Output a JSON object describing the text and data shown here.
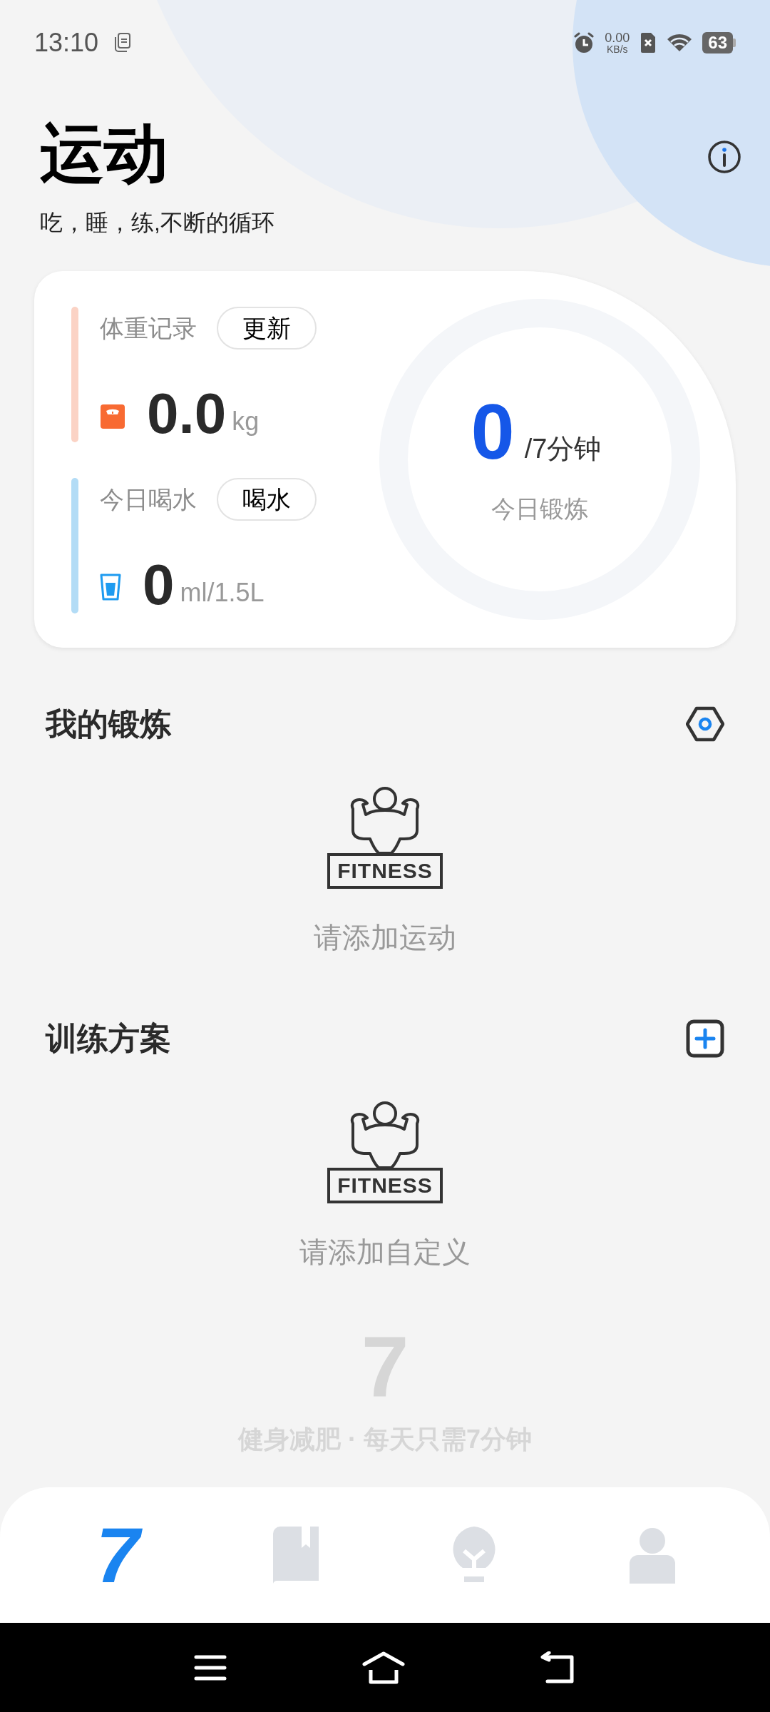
{
  "status_bar": {
    "time": "13:10",
    "net_speed": "0.00",
    "net_unit": "KB/s",
    "battery": "63"
  },
  "header": {
    "title": "运动",
    "subtitle": "吃，睡，练,不断的循环"
  },
  "summary_card": {
    "weight": {
      "label": "体重记录",
      "button": "更新",
      "value": "0.0",
      "unit": "kg"
    },
    "water": {
      "label": "今日喝水",
      "button": "喝水",
      "value": "0",
      "unit": "ml/1.5L"
    },
    "exercise": {
      "value": "0",
      "goal": "/7分钟",
      "label": "今日锻炼"
    }
  },
  "sections": [
    {
      "title": "我的锻炼",
      "kind": "settings",
      "badge": "FITNESS",
      "empty_text": "请添加运动"
    },
    {
      "title": "训练方案",
      "kind": "add",
      "badge": "FITNESS",
      "empty_text": "请添加自定义"
    }
  ],
  "slogan": {
    "mark": "7",
    "text": "健身减肥 · 每天只需7分钟"
  },
  "bottom_nav": [
    {
      "kind": "logo",
      "label": "7",
      "selected": true
    },
    {
      "kind": "book",
      "selected": false
    },
    {
      "kind": "bulb",
      "selected": false
    },
    {
      "kind": "person",
      "selected": false
    }
  ]
}
